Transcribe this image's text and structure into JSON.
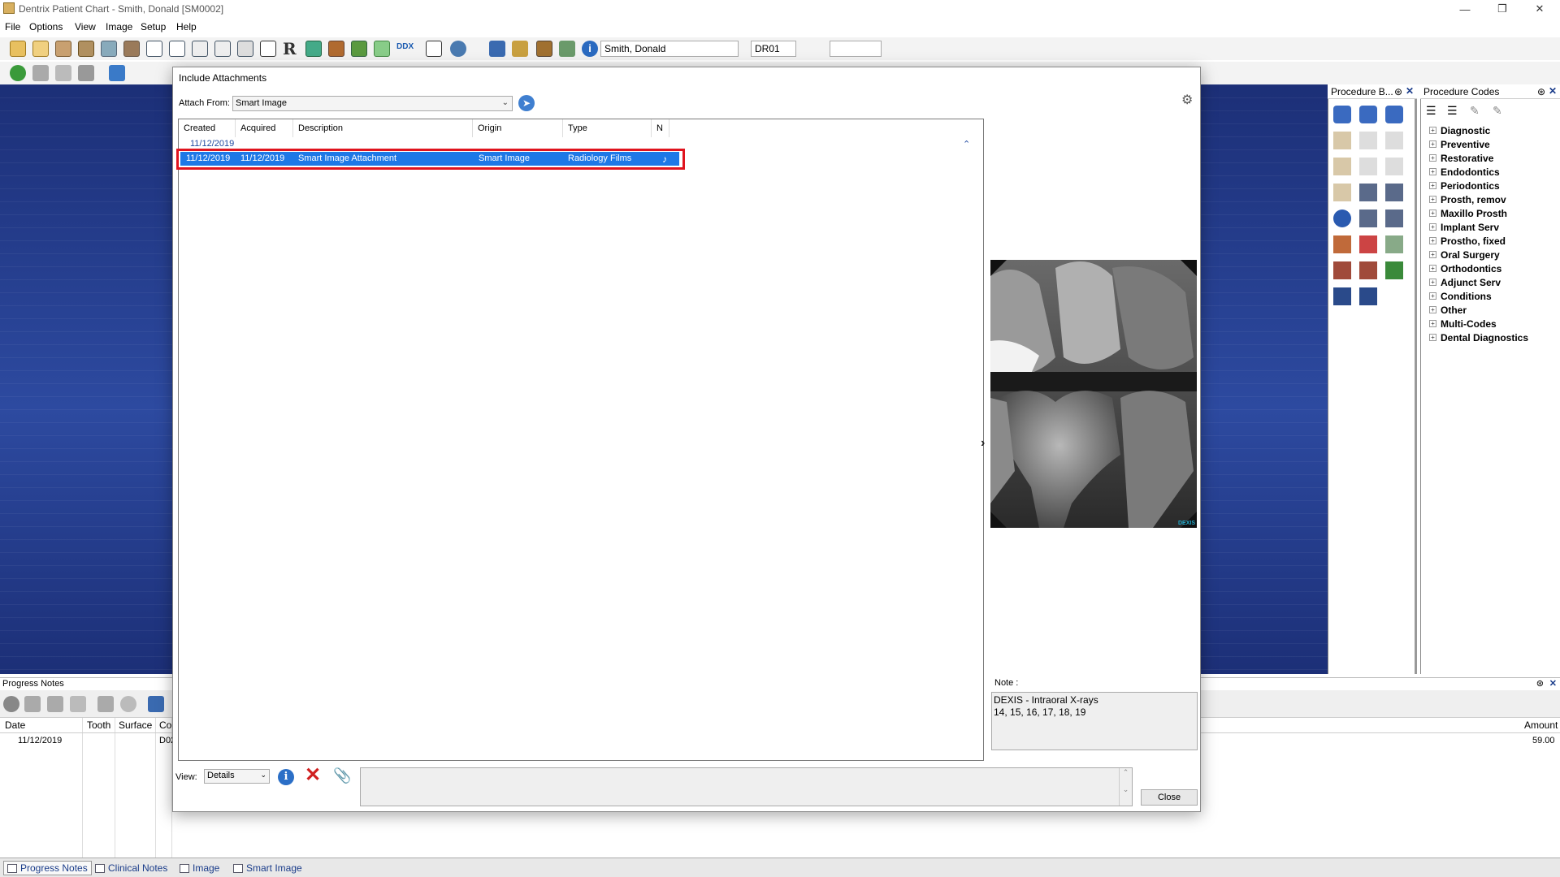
{
  "window": {
    "title": "Dentrix Patient Chart - Smith, Donald [SM0002]"
  },
  "menu": [
    "File",
    "Options",
    "View",
    "Image",
    "Setup",
    "Help"
  ],
  "toolbar": {
    "patient_name": "Smith, Donald",
    "provider": "DR01"
  },
  "dialog": {
    "title": "Include Attachments",
    "attach_from_label": "Attach From:",
    "attach_from_value": "Smart Image",
    "columns": [
      "Created",
      "Acquired",
      "Description",
      "Origin",
      "Type",
      "N"
    ],
    "group_label": "11/12/2019",
    "selected_row": {
      "created": "11/12/2019",
      "acquired": "11/12/2019",
      "description": "Smart Image Attachment",
      "origin": "Smart Image",
      "type": "Radiology Films"
    },
    "preview_brand": "DEXIS",
    "note_label": "Note :",
    "note_text": "DEXIS - Intraoral X-rays\n 14, 15, 16, 17, 18, 19",
    "view_label": "View:",
    "view_value": "Details",
    "close_label": "Close"
  },
  "panels": {
    "procedure_buttons_title": "Procedure B...",
    "procedure_codes_title": "Procedure Codes",
    "procedure_codes": [
      "Diagnostic",
      "Preventive",
      "Restorative",
      "Endodontics",
      "Periodontics",
      "Prosth, remov",
      "Maxillo Prosth",
      "Implant Serv",
      "Prostho, fixed",
      "Oral Surgery",
      "Orthodontics",
      "Adjunct Serv",
      "Conditions",
      "Other",
      "Multi-Codes",
      "Dental Diagnostics"
    ]
  },
  "progress_notes": {
    "title": "Progress Notes",
    "columns": [
      "Date",
      "Tooth",
      "Surface",
      "Co"
    ],
    "amount_header": "Amount",
    "row": {
      "date": "11/12/2019",
      "code": "D02",
      "amount": "59.00"
    }
  },
  "bottom_tabs": [
    "Progress Notes",
    "Clinical Notes",
    "Image",
    "Smart Image"
  ],
  "colors": {
    "selection": "#1e78e6",
    "highlight_border": "#e0141e",
    "chart_background": "#2d4aa0"
  }
}
